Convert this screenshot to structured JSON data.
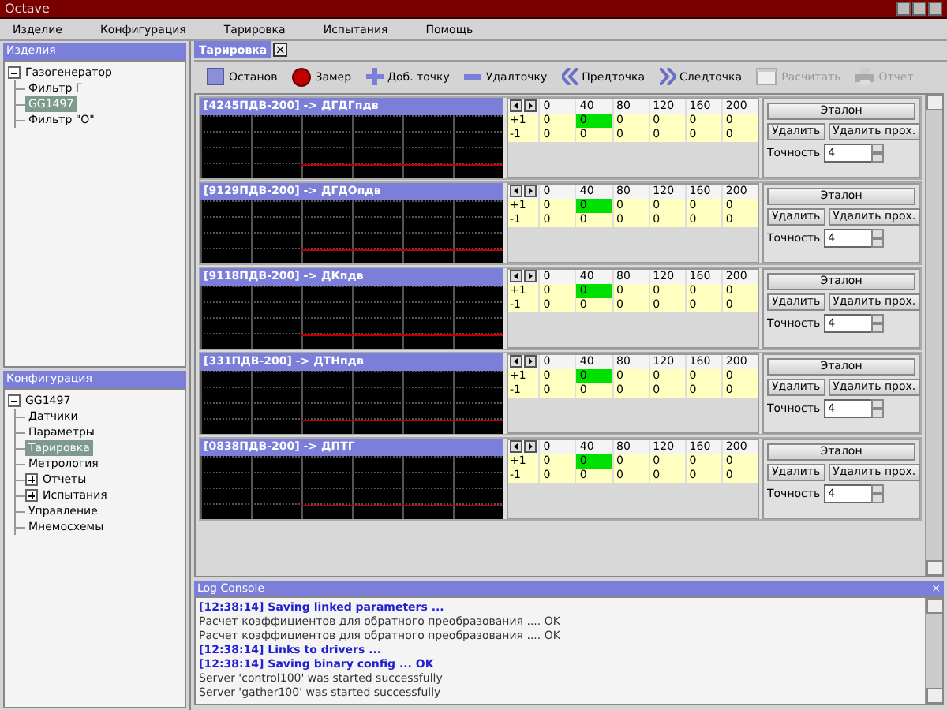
{
  "window": {
    "title": "Octave"
  },
  "menu": [
    "Изделие",
    "Конфигурация",
    "Тарировка",
    "Испытания",
    "Помощь"
  ],
  "products_panel": {
    "title": "Изделия",
    "tree": [
      {
        "label": "Газогенератор",
        "expanded": true,
        "selected": false,
        "children": [
          {
            "label": "Фильтр Г",
            "selected": false
          },
          {
            "label": "GG1497",
            "selected": true
          },
          {
            "label": "Фильтр \"О\"",
            "selected": false
          }
        ]
      }
    ]
  },
  "config_panel": {
    "title": "Конфигурация",
    "tree": [
      {
        "label": "GG1497",
        "expanded": true,
        "selected": false,
        "children": [
          {
            "label": "Датчики",
            "selected": false
          },
          {
            "label": "Параметры",
            "selected": false
          },
          {
            "label": "Тарировка",
            "selected": true
          },
          {
            "label": "Метрология",
            "selected": false
          },
          {
            "label": "Отчеты",
            "expanded": false,
            "selected": false
          },
          {
            "label": "Испытания",
            "expanded": false,
            "selected": false
          },
          {
            "label": "Управление",
            "selected": false
          },
          {
            "label": "Мнемосхемы",
            "selected": false
          }
        ]
      }
    ]
  },
  "tabs": [
    {
      "label": "Тарировка",
      "selected": true,
      "close": "×"
    }
  ],
  "toolbar": [
    {
      "kind": "stop",
      "label": "Останов",
      "disabled": false
    },
    {
      "kind": "record",
      "label": "Замер",
      "disabled": false
    },
    {
      "kind": "add",
      "label": "Доб. точку",
      "disabled": false
    },
    {
      "kind": "remove",
      "label": "Удалточку",
      "disabled": false
    },
    {
      "kind": "prev",
      "label": "Предточка",
      "disabled": false
    },
    {
      "kind": "next",
      "label": "Следточка",
      "disabled": false
    },
    {
      "kind": "calc",
      "label": "Расчитать",
      "disabled": true
    },
    {
      "kind": "print",
      "label": "Отчет",
      "disabled": true
    }
  ],
  "sensors": [
    {
      "title": "[4245ПДВ-200] -> ДГДГпдв",
      "columns": [
        "0",
        "40",
        "80",
        "120",
        "160",
        "200"
      ],
      "rows": [
        {
          "label": "+1",
          "cells": [
            {
              "value": "0",
              "selected": false
            },
            {
              "value": "0",
              "selected": true
            },
            {
              "value": "0",
              "selected": false
            },
            {
              "value": "0",
              "selected": false
            },
            {
              "value": "0",
              "selected": false
            },
            {
              "value": "0",
              "selected": false
            }
          ]
        },
        {
          "label": "-1",
          "cells": [
            {
              "value": "0",
              "selected": false
            },
            {
              "value": "0",
              "selected": false
            },
            {
              "value": "0",
              "selected": false
            },
            {
              "value": "0",
              "selected": false
            },
            {
              "value": "0",
              "selected": false
            },
            {
              "value": "0",
              "selected": false
            }
          ]
        }
      ],
      "reference_button": "Эталон",
      "delete_button": "Удалить",
      "delete_pass_button": "Удалить прох.",
      "precision_label": "Точность",
      "precision": "4"
    },
    {
      "title": "[9129ПДВ-200] -> ДГДОпдв",
      "columns": [
        "0",
        "40",
        "80",
        "120",
        "160",
        "200"
      ],
      "rows": [
        {
          "label": "+1",
          "cells": [
            {
              "value": "0",
              "selected": false
            },
            {
              "value": "0",
              "selected": true
            },
            {
              "value": "0",
              "selected": false
            },
            {
              "value": "0",
              "selected": false
            },
            {
              "value": "0",
              "selected": false
            },
            {
              "value": "0",
              "selected": false
            }
          ]
        },
        {
          "label": "-1",
          "cells": [
            {
              "value": "0",
              "selected": false
            },
            {
              "value": "0",
              "selected": false
            },
            {
              "value": "0",
              "selected": false
            },
            {
              "value": "0",
              "selected": false
            },
            {
              "value": "0",
              "selected": false
            },
            {
              "value": "0",
              "selected": false
            }
          ]
        }
      ],
      "reference_button": "Эталон",
      "delete_button": "Удалить",
      "delete_pass_button": "Удалить прох.",
      "precision_label": "Точность",
      "precision": "4"
    },
    {
      "title": "[9118ПДВ-200] -> ДКпдв",
      "columns": [
        "0",
        "40",
        "80",
        "120",
        "160",
        "200"
      ],
      "rows": [
        {
          "label": "+1",
          "cells": [
            {
              "value": "0",
              "selected": false
            },
            {
              "value": "0",
              "selected": true
            },
            {
              "value": "0",
              "selected": false
            },
            {
              "value": "0",
              "selected": false
            },
            {
              "value": "0",
              "selected": false
            },
            {
              "value": "0",
              "selected": false
            }
          ]
        },
        {
          "label": "-1",
          "cells": [
            {
              "value": "0",
              "selected": false
            },
            {
              "value": "0",
              "selected": false
            },
            {
              "value": "0",
              "selected": false
            },
            {
              "value": "0",
              "selected": false
            },
            {
              "value": "0",
              "selected": false
            },
            {
              "value": "0",
              "selected": false
            }
          ]
        }
      ],
      "reference_button": "Эталон",
      "delete_button": "Удалить",
      "delete_pass_button": "Удалить прох.",
      "precision_label": "Точность",
      "precision": "4"
    },
    {
      "title": "[331ПДВ-200] -> ДТНпдв",
      "columns": [
        "0",
        "40",
        "80",
        "120",
        "160",
        "200"
      ],
      "rows": [
        {
          "label": "+1",
          "cells": [
            {
              "value": "0",
              "selected": false
            },
            {
              "value": "0",
              "selected": true
            },
            {
              "value": "0",
              "selected": false
            },
            {
              "value": "0",
              "selected": false
            },
            {
              "value": "0",
              "selected": false
            },
            {
              "value": "0",
              "selected": false
            }
          ]
        },
        {
          "label": "-1",
          "cells": [
            {
              "value": "0",
              "selected": false
            },
            {
              "value": "0",
              "selected": false
            },
            {
              "value": "0",
              "selected": false
            },
            {
              "value": "0",
              "selected": false
            },
            {
              "value": "0",
              "selected": false
            },
            {
              "value": "0",
              "selected": false
            }
          ]
        }
      ],
      "reference_button": "Эталон",
      "delete_button": "Удалить",
      "delete_pass_button": "Удалить прох.",
      "precision_label": "Точность",
      "precision": "4"
    },
    {
      "title": "[0838ПДВ-200] -> ДПТГ",
      "columns": [
        "0",
        "40",
        "80",
        "120",
        "160",
        "200"
      ],
      "rows": [
        {
          "label": "+1",
          "cells": [
            {
              "value": "0",
              "selected": false
            },
            {
              "value": "0",
              "selected": true
            },
            {
              "value": "0",
              "selected": false
            },
            {
              "value": "0",
              "selected": false
            },
            {
              "value": "0",
              "selected": false
            },
            {
              "value": "0",
              "selected": false
            }
          ]
        },
        {
          "label": "-1",
          "cells": [
            {
              "value": "0",
              "selected": false
            },
            {
              "value": "0",
              "selected": false
            },
            {
              "value": "0",
              "selected": false
            },
            {
              "value": "0",
              "selected": false
            },
            {
              "value": "0",
              "selected": false
            },
            {
              "value": "0",
              "selected": false
            }
          ]
        }
      ],
      "reference_button": "Эталон",
      "delete_button": "Удалить",
      "delete_pass_button": "Удалить прох.",
      "precision_label": "Точность",
      "precision": "4"
    }
  ],
  "log_console": {
    "title": "Log Console",
    "close": "×",
    "lines": [
      {
        "kind": "event",
        "text": "[12:38:14] Saving linked parameters ..."
      },
      {
        "kind": "plain",
        "text": "Расчет коэффициентов для обратного преобразования .... OK"
      },
      {
        "kind": "plain",
        "text": "Расчет коэффициентов для обратного преобразования .... OK"
      },
      {
        "kind": "event",
        "text": "[12:38:14] Links to drivers ..."
      },
      {
        "kind": "event",
        "text": "[12:38:14] Saving binary config ... OK"
      },
      {
        "kind": "plain",
        "text": "Server 'control100' was started successfully"
      },
      {
        "kind": "plain",
        "text": "Server 'gather100' was started successfully"
      }
    ]
  }
}
